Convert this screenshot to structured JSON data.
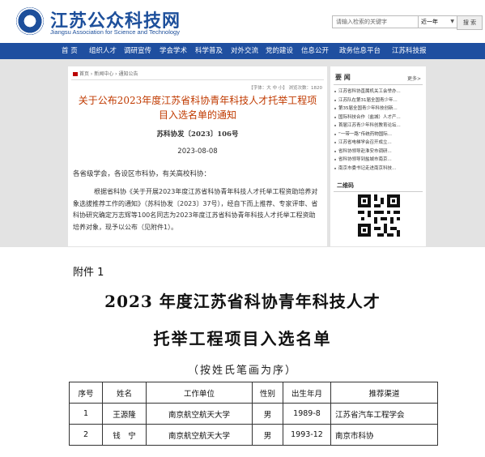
{
  "header": {
    "site_title": "江苏公众科技网",
    "site_subtitle": "Jiangsu Association for Science and Technology",
    "search_placeholder": "请输入检索的关键字",
    "search_range": "近一年",
    "search_button": "搜 索"
  },
  "nav": [
    "首 页",
    "组织人才",
    "调研宣传",
    "学会学术",
    "科学普及",
    "对外交流",
    "党的建设",
    "信息公开",
    "政务信息平台",
    "江苏科技报"
  ],
  "article": {
    "breadcrumb": [
      "首页",
      "新闻中心",
      "通知公告"
    ],
    "font_size_label": "【字体：大 中 小】 浏览次数：1820",
    "title": "关于公布2023年度江苏省科协青年科技人才托举工程项目入选名单的通知",
    "doc_no": "苏科协发〔2023〕106号",
    "date": "2023-08-08",
    "salutation": "各省级学会，各设区市科协，有关高校科协：",
    "body": "根据省科协《关于开展2023年度江苏省科协青年科技人才托举工程资助培养对象选拔推荐工作的通知》（苏科协发〔2023〕37号），经自下而上推荐、专家评审、省科协研究确定万志辉等100名同志为2023年度江苏省科协青年科技人才托举工程资助培养对象，现予以公布（见附件1）。"
  },
  "sidebar": {
    "heading": "要 闻",
    "more": "更多>",
    "items": [
      "江苏省科协直属机关工会举办...",
      "江苏队在第31届全国青少年...",
      "第35届全国青少年科技创新...",
      "国际科技合作（盐城）人才产...",
      "首届江苏青少年科创教育论坛...",
      "“一带一路”传统药物国际...",
      "江苏省电梯学会召开成立...",
      "省科协领导赴淮安市调研...",
      "省科协领导到盐城市南京...",
      "南京市委书记走进南京科技..."
    ],
    "qr_heading": "二维码"
  },
  "attachment": {
    "label": "附件 1",
    "title_line1": "2023 年度江苏省科协青年科技人才",
    "title_line2": "托举工程项目入选名单",
    "subtitle": "（按姓氏笔画为序）",
    "columns": [
      "序号",
      "姓名",
      "工作单位",
      "性别",
      "出生年月",
      "推荐渠道"
    ],
    "rows": [
      [
        "1",
        "王源隆",
        "南京航空航天大学",
        "男",
        "1989-8",
        "江苏省汽车工程学会"
      ],
      [
        "2",
        "钱　宁",
        "南京航空航天大学",
        "男",
        "1993-12",
        "南京市科协"
      ]
    ]
  },
  "colors": {
    "brand_blue": "#1d4f9b",
    "nav_blue": "#1f4fa0",
    "title_red": "#c03a00",
    "band_gray": "#e3e3e3"
  }
}
